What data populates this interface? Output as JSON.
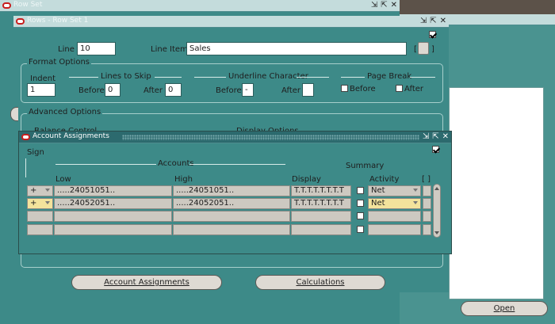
{
  "row_set_window": {
    "title": "Row Set"
  },
  "rows_window": {
    "title": "Rows - Row Set 1",
    "line_label": "Line",
    "line_value": "10",
    "line_item_label": "Line Item",
    "line_item_value": "Sales",
    "bracket_left": "[",
    "bracket_right": "]",
    "format_options": {
      "group_label": "Format Options",
      "indent_label": "Indent",
      "indent_value": "1",
      "lines_to_skip_label": "Lines to Skip",
      "before_label": "Before",
      "before_value": "0",
      "after_label": "After",
      "after_value": "0",
      "underline_label": "Underline Character",
      "u_before_label": "Before",
      "u_before_value": "-",
      "u_after_label": "After",
      "u_after_value": "",
      "page_break_label": "Page Break",
      "pb_before_label": "Before",
      "pb_after_label": "After"
    },
    "advanced_options": {
      "group_label": "Advanced Options",
      "balance_control_label": "Balance Control",
      "display_options_label": "Display Options"
    },
    "buttons": {
      "account_assignments": "Account Assignments",
      "calculations": "Calculations"
    }
  },
  "open_button": "Open",
  "account_window": {
    "title": "Account Assignments",
    "sign_label": "Sign",
    "accounts_label": "Accounts",
    "summary_label": "Summary",
    "columns": {
      "low": "Low",
      "high": "High",
      "display": "Display",
      "activity": "Activity",
      "brackets": "[ ]"
    },
    "rows": [
      {
        "sign": "+",
        "low": ".....24051051..",
        "high": ".....24051051..",
        "display": "T.T.T.T.T.T.T.T",
        "summary": false,
        "activity": "Net"
      },
      {
        "sign": "+",
        "low": ".....24052051..",
        "high": ".....24052051..",
        "display": "T.T.T.T.T.T.T.T",
        "summary": false,
        "activity": "Net"
      },
      {
        "sign": "",
        "low": "",
        "high": "",
        "display": "",
        "summary": false,
        "activity": ""
      },
      {
        "sign": "",
        "low": "",
        "high": "",
        "display": "",
        "summary": false,
        "activity": ""
      }
    ]
  },
  "colors": {
    "panel": "#3d8a88",
    "title_active": "#2c6a6e",
    "title_inactive": "#8cc4c6",
    "field": "#ffffff",
    "grid_cell": "#cdc9c1",
    "current_cell": "#f3e39c"
  },
  "icons": [
    "oracle-icon",
    "minimize-icon",
    "maximize-icon",
    "close-icon",
    "dropdown-arrow-icon",
    "scroll-up-icon",
    "scroll-down-icon"
  ]
}
